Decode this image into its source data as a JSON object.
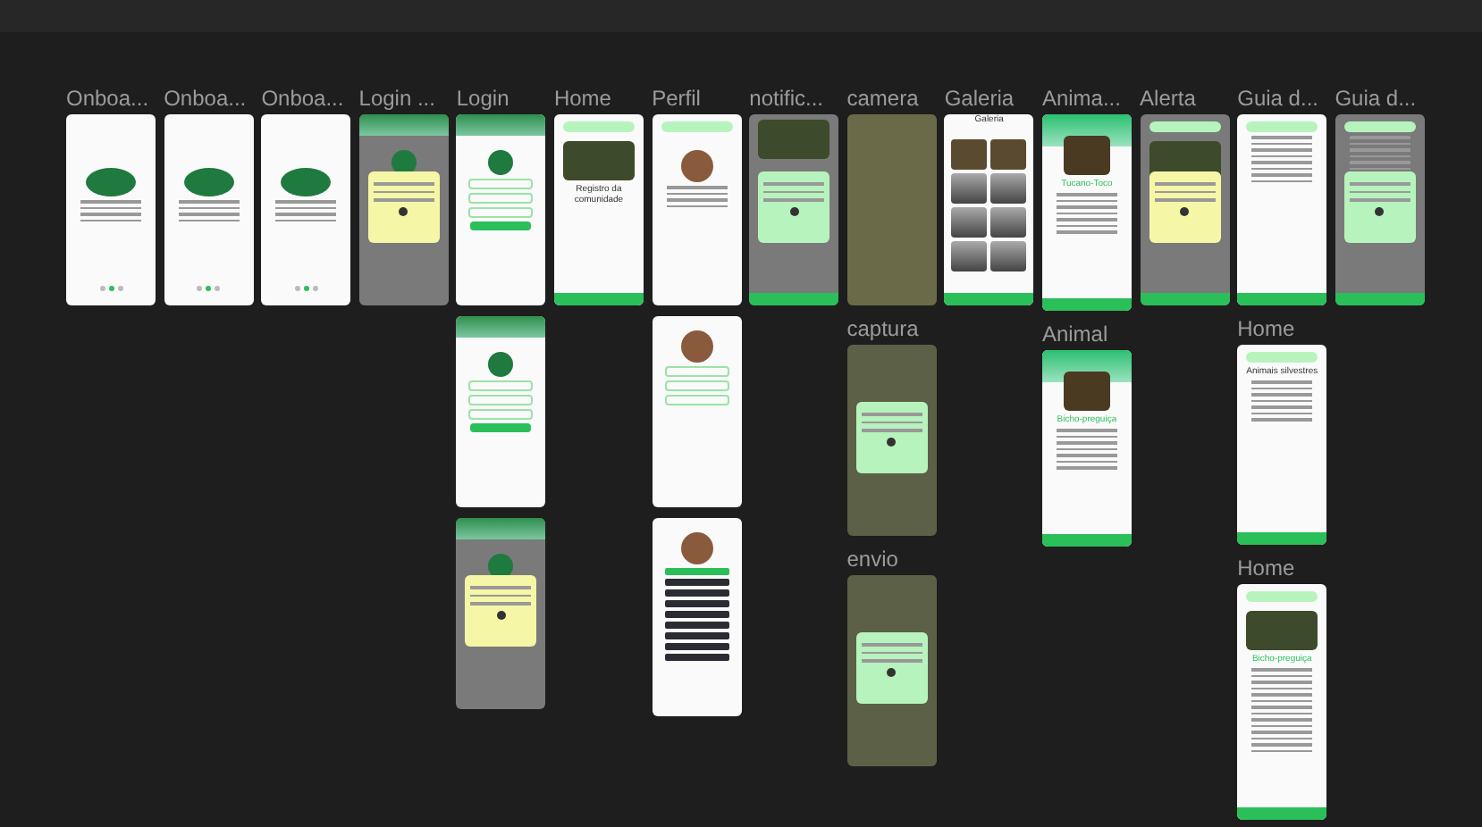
{
  "columns": [
    {
      "frames": [
        {
          "label": "Onboa...",
          "kind": "onboarding"
        }
      ]
    },
    {
      "frames": [
        {
          "label": "Onboa...",
          "kind": "onboarding"
        }
      ]
    },
    {
      "frames": [
        {
          "label": "Onboa...",
          "kind": "onboarding"
        }
      ]
    },
    {
      "frames": [
        {
          "label": "Login ...",
          "kind": "login-alert"
        }
      ]
    },
    {
      "frames": [
        {
          "label": "Login",
          "kind": "login"
        },
        {
          "kind": "login"
        },
        {
          "kind": "login-alert"
        }
      ]
    },
    {
      "frames": [
        {
          "label": "Home",
          "kind": "home",
          "title": "Registro da comunidade"
        }
      ]
    },
    {
      "frames": [
        {
          "label": "Perfil",
          "kind": "profile"
        },
        {
          "kind": "profile-edit"
        },
        {
          "kind": "profile-menu"
        }
      ]
    },
    {
      "frames": [
        {
          "label": "notific...",
          "kind": "notification"
        }
      ]
    },
    {
      "frames": [
        {
          "label": "camera",
          "kind": "camera"
        },
        {
          "label": "captura",
          "kind": "camera-dialog"
        },
        {
          "label": "envio",
          "kind": "camera-dialog"
        }
      ]
    },
    {
      "frames": [
        {
          "label": "Galeria",
          "kind": "gallery",
          "title": "Galeria"
        }
      ]
    },
    {
      "frames": [
        {
          "label": "Anima...",
          "kind": "animal",
          "title": "Tucano-Toco"
        },
        {
          "label": "Animal",
          "kind": "animal",
          "title": "Bicho-preguiça"
        }
      ]
    },
    {
      "frames": [
        {
          "label": "Alerta",
          "kind": "alert"
        }
      ]
    },
    {
      "frames": [
        {
          "label": "Guia d...",
          "kind": "guide"
        },
        {
          "label": "Home",
          "kind": "list",
          "title": "Animais silvestres"
        },
        {
          "label": "Home",
          "kind": "article",
          "title": "Bicho-preguiça"
        }
      ]
    },
    {
      "frames": [
        {
          "label": "Guia d...",
          "kind": "guide-dim"
        }
      ]
    }
  ]
}
